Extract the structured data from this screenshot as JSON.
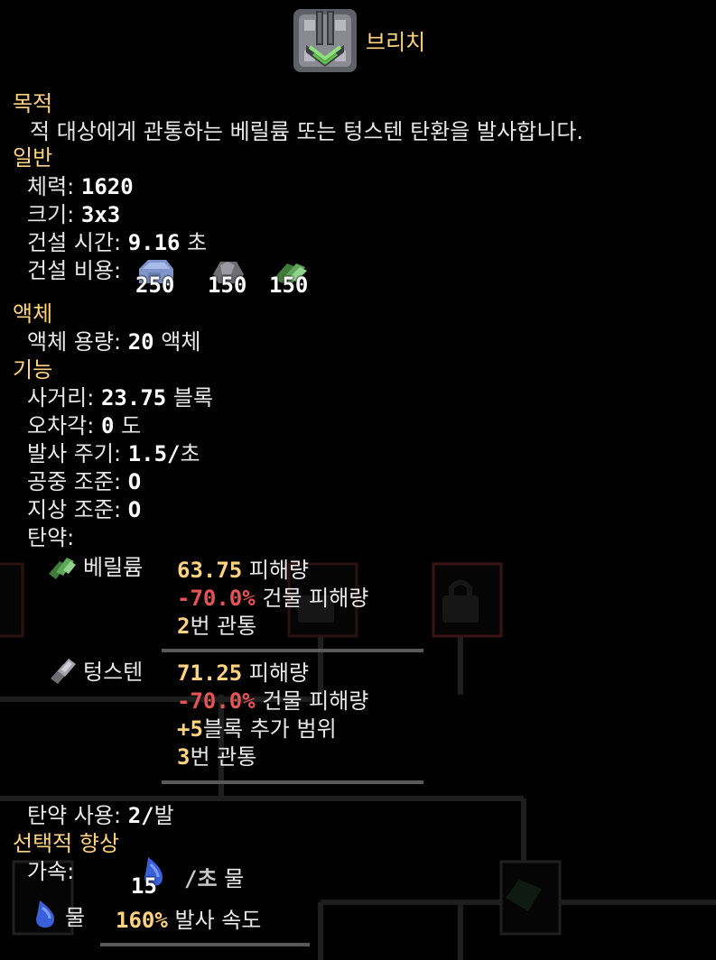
{
  "block": {
    "icon": "breach-turret-icon",
    "name": "브리치"
  },
  "purpose": {
    "header": "목적",
    "description": "적 대상에게 관통하는 베릴륨 또는 텅스텐 탄환을 발사합니다."
  },
  "general": {
    "header": "일반",
    "health_label": "체력:",
    "health_value": "1620",
    "size_label": "크기:",
    "size_value": "3x3",
    "build_time_label": "건설 시간:",
    "build_time_value": "9.16",
    "build_time_unit": "초",
    "build_cost_label": "건설 비용:",
    "costs": [
      {
        "icon": "beryllium-item-icon",
        "amount": "250"
      },
      {
        "icon": "tungsten-item-icon",
        "amount": "150"
      },
      {
        "icon": "silicon-item-icon",
        "amount": "150"
      }
    ]
  },
  "liquids": {
    "header": "액체",
    "capacity_label": "액체 용량:",
    "capacity_value": "20",
    "capacity_unit": "액체"
  },
  "function": {
    "header": "기능",
    "range_label": "사거리:",
    "range_value": "23.75",
    "range_unit": "블록",
    "inaccuracy_label": "오차각:",
    "inaccuracy_value": "0",
    "inaccuracy_unit": "도",
    "reload_label": "발사 주기:",
    "reload_value": "1.5/",
    "reload_unit": "초",
    "target_air_label": "공중 조준:",
    "target_air_value": "O",
    "target_ground_label": "지상 조준:",
    "target_ground_value": "O",
    "ammo_label": "탄약:",
    "ammo": [
      {
        "icon": "beryllium-ammo-icon",
        "name": "베릴륨",
        "damage_value": "63.75",
        "damage_label": "피해량",
        "building_value": "-70.0%",
        "building_label": "건물 피해량",
        "pierce_value": "2",
        "pierce_label": "번 관통"
      },
      {
        "icon": "tungsten-ammo-icon",
        "name": "텅스텐",
        "damage_value": "71.25",
        "damage_label": "피해량",
        "building_value": "-70.0%",
        "building_label": "건물 피해량",
        "range_value": "+5",
        "range_label": "블록 추가 범위",
        "pierce_value": "3",
        "pierce_label": "번 관통"
      }
    ],
    "ammo_use_label": "탄약 사용:",
    "ammo_use_value": "2/",
    "ammo_use_unit": "발"
  },
  "optional": {
    "header": "선택적 향상",
    "boost_label": "가속:",
    "coolant_amount": "15",
    "coolant_rate": "/초",
    "coolant_name": "물",
    "coolant_icon": "water-drop-icon",
    "boost_item_name": "물",
    "boost_value": "160%",
    "boost_label_text": "발사 속도"
  },
  "colors": {
    "header": "#ffd37f",
    "positive": "#ffd37f",
    "negative": "#e55454",
    "text": "#e8e8e8"
  }
}
